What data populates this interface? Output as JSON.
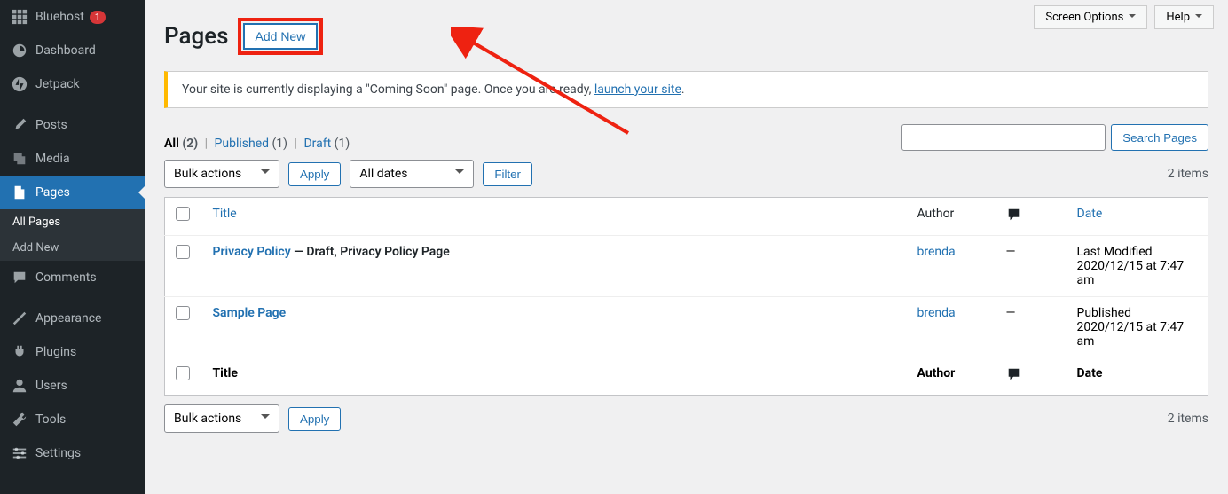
{
  "sidebar": {
    "items": [
      {
        "label": "Bluehost",
        "badge": "1"
      },
      {
        "label": "Dashboard"
      },
      {
        "label": "Jetpack"
      },
      {
        "label": "Posts"
      },
      {
        "label": "Media"
      },
      {
        "label": "Pages"
      },
      {
        "label": "Comments"
      },
      {
        "label": "Appearance"
      },
      {
        "label": "Plugins"
      },
      {
        "label": "Users"
      },
      {
        "label": "Tools"
      },
      {
        "label": "Settings"
      }
    ],
    "submenu": [
      {
        "label": "All Pages"
      },
      {
        "label": "Add New"
      }
    ]
  },
  "top_buttons": {
    "screen_options": "Screen Options",
    "help": "Help"
  },
  "heading": "Pages",
  "add_new": "Add New",
  "notice": {
    "pre": "Your site is currently displaying a \"Coming Soon\" page. Once you are ready, ",
    "link": "launch your site",
    "post": "."
  },
  "status": {
    "all_label": "All",
    "all_count": "(2)",
    "published_label": "Published",
    "published_count": "(1)",
    "draft_label": "Draft",
    "draft_count": "(1)"
  },
  "search": {
    "button": "Search Pages"
  },
  "bulk_actions": "Bulk actions",
  "apply": "Apply",
  "all_dates": "All dates",
  "filter": "Filter",
  "items_count": "2 items",
  "columns": {
    "title": "Title",
    "author": "Author",
    "date": "Date"
  },
  "rows": [
    {
      "title": "Privacy Policy",
      "state": " — Draft, Privacy Policy Page",
      "author": "brenda",
      "comments": "—",
      "date_status": "Last Modified",
      "date_value": "2020/12/15 at 7:47 am"
    },
    {
      "title": "Sample Page",
      "state": "",
      "author": "brenda",
      "comments": "—",
      "date_status": "Published",
      "date_value": "2020/12/15 at 7:47 am"
    }
  ]
}
